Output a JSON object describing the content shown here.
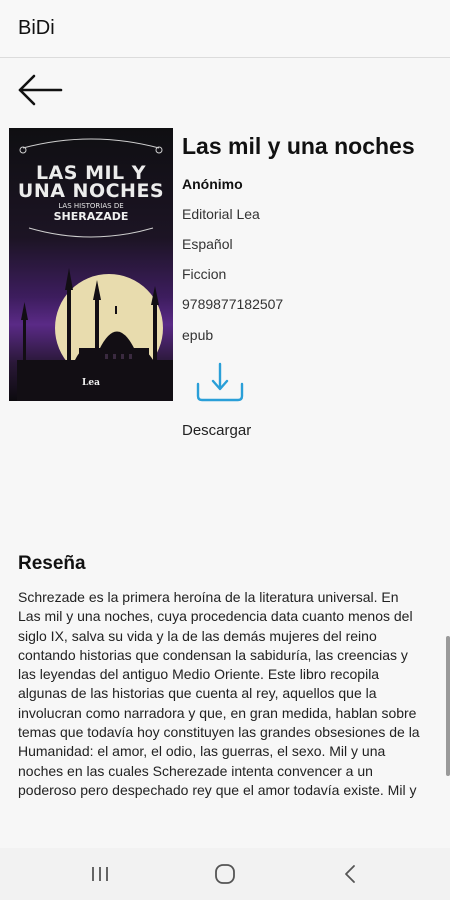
{
  "app": {
    "title": "BiDi"
  },
  "book": {
    "title": "Las mil y una noches",
    "author": "Anónimo",
    "publisher": "Editorial Lea",
    "language": "Español",
    "genre": "Ficcion",
    "isbn": "9789877182507",
    "format": "epub",
    "download_label": "Descargar",
    "cover": {
      "title_line1": "LAS MIL Y",
      "title_line2": "UNA NOCHES",
      "subtitle_line1": "LAS HISTORIAS DE",
      "subtitle_line2": "SHERAZADE",
      "publisher_logo": "Lea"
    }
  },
  "review": {
    "heading": "Reseña",
    "text": "Schrezade es la primera heroína de la literatura universal. En Las mil y una noches, cuya procedencia data cuanto menos del siglo IX, salva su vida y la de las demás mujeres del reino contando historias que condensan la sabiduría, las creencias y las leyendas del antiguo Medio Oriente. Este libro recopila algunas de las historias que cuenta al rey, aquellos que la involucran como narradora y que, en gran medida, hablan sobre temas que todavía hoy constituyen las grandes obsesiones de la Humanidad: el amor, el odio, las guerras, el sexo. Mil y una noches en las cuales Scherezade intenta convencer a un poderoso pero despechado rey que el amor todavía existe. Mil y"
  },
  "icons": {
    "back": "arrow-left-icon",
    "download": "download-icon",
    "recents": "recents-icon",
    "home": "home-icon",
    "system_back": "chevron-left-icon"
  },
  "colors": {
    "accent": "#2a9fd8",
    "background": "#f7f7f7"
  }
}
